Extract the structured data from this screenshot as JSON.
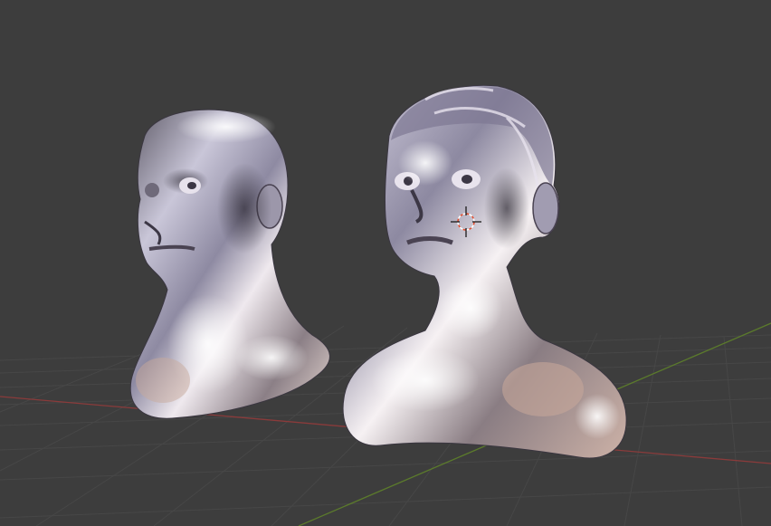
{
  "viewport": {
    "background_color": "#3d3d3d",
    "grid_color": "#464646",
    "x_axis_color": "#8a3b3b",
    "y_axis_color": "#5b7a2c",
    "material": "metallic-chrome",
    "material_colors": {
      "highlight": "#f4f0f6",
      "mid": "#a7a4bd",
      "shadow": "#4d4756",
      "warm": "#c7a79a"
    },
    "objects": [
      {
        "name": "bald-head-bust"
      },
      {
        "name": "haired-head-bust",
        "selected": true
      }
    ],
    "cursor": {
      "name": "3d-cursor",
      "colors": [
        "#e24a2a",
        "#ffffff"
      ]
    }
  }
}
